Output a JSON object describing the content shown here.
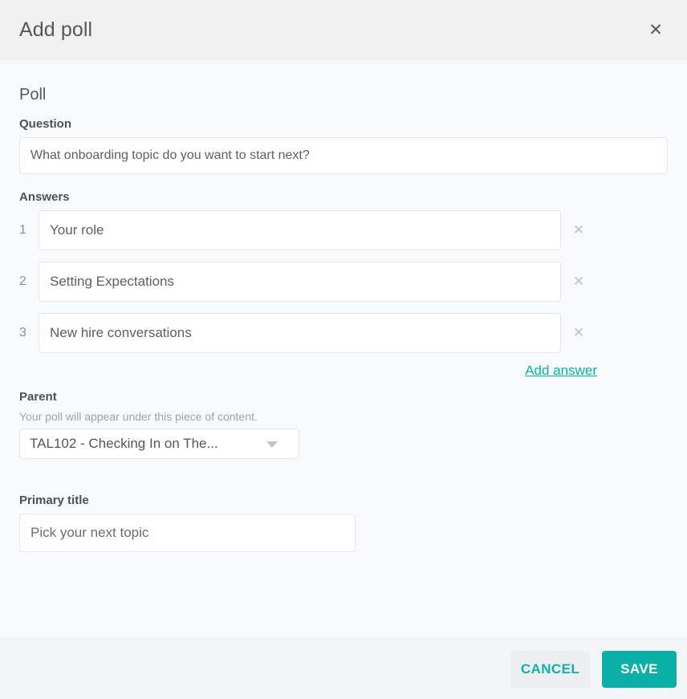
{
  "header": {
    "title": "Add poll",
    "close_label": "✕"
  },
  "body": {
    "section_title": "Poll",
    "question": {
      "label": "Question",
      "value": "What onboarding topic do you want to start next?",
      "placeholder": "What onboarding topic do you want to start next?"
    },
    "answers": {
      "label": "Answers",
      "remove_label": "✕",
      "add_link": "Add answer",
      "items": [
        {
          "index": "1",
          "value": "Your role"
        },
        {
          "index": "2",
          "value": "Setting Expectations"
        },
        {
          "index": "3",
          "value": "New hire conversations"
        }
      ]
    },
    "parent": {
      "label": "Parent",
      "help": "Your poll will appear under this piece of content.",
      "selected": "TAL102 - Checking In on The..."
    },
    "primary_title": {
      "label": "Primary title",
      "value": "Pick your next topic",
      "placeholder": "Pick your next topic"
    }
  },
  "footer": {
    "cancel_label": "CANCEL",
    "save_label": "SAVE"
  },
  "colors": {
    "accent": "#08b0a8",
    "link": "#08b2ab",
    "header_bg": "#f0f0f0",
    "body_bg": "#f8f9fb",
    "footer_bg": "#f4f5f7"
  }
}
